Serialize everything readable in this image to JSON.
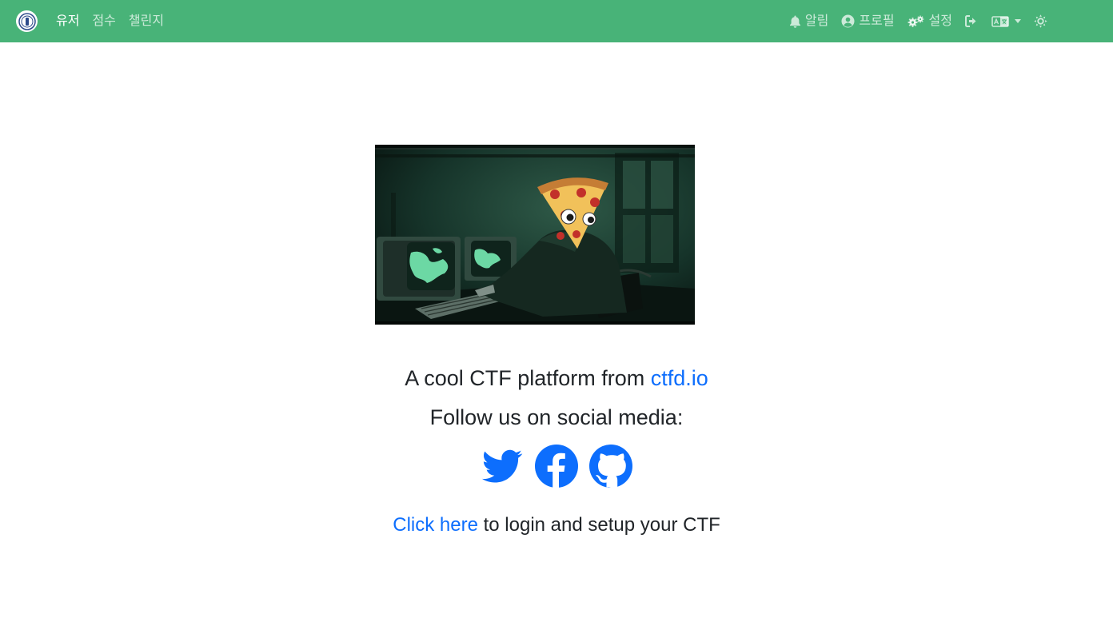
{
  "nav": {
    "left": [
      {
        "label": "유저",
        "active": true
      },
      {
        "label": "점수",
        "active": false
      },
      {
        "label": "챌린지",
        "active": false
      }
    ],
    "right": {
      "notifications": {
        "label": "알림",
        "icon": "bell-icon"
      },
      "profile": {
        "label": "프로필",
        "icon": "user-circle-icon"
      },
      "settings": {
        "label": "설정",
        "icon": "gears-icon"
      },
      "logout": {
        "icon": "sign-out-icon"
      },
      "language": {
        "icon": "language-icon"
      },
      "theme": {
        "icon": "theme-toggle-icon"
      }
    }
  },
  "main": {
    "hero_alt": "Pizza-headed hacker at retro computers",
    "tagline_prefix": "A cool CTF platform from ",
    "tagline_link": "ctfd.io",
    "follow": "Follow us on social media:",
    "social": [
      "twitter-icon",
      "facebook-icon",
      "github-icon"
    ],
    "setup_link": "Click here",
    "setup_rest": " to login and setup your CTF"
  },
  "colors": {
    "navbar": "#48b378",
    "link": "#0d6efd"
  }
}
